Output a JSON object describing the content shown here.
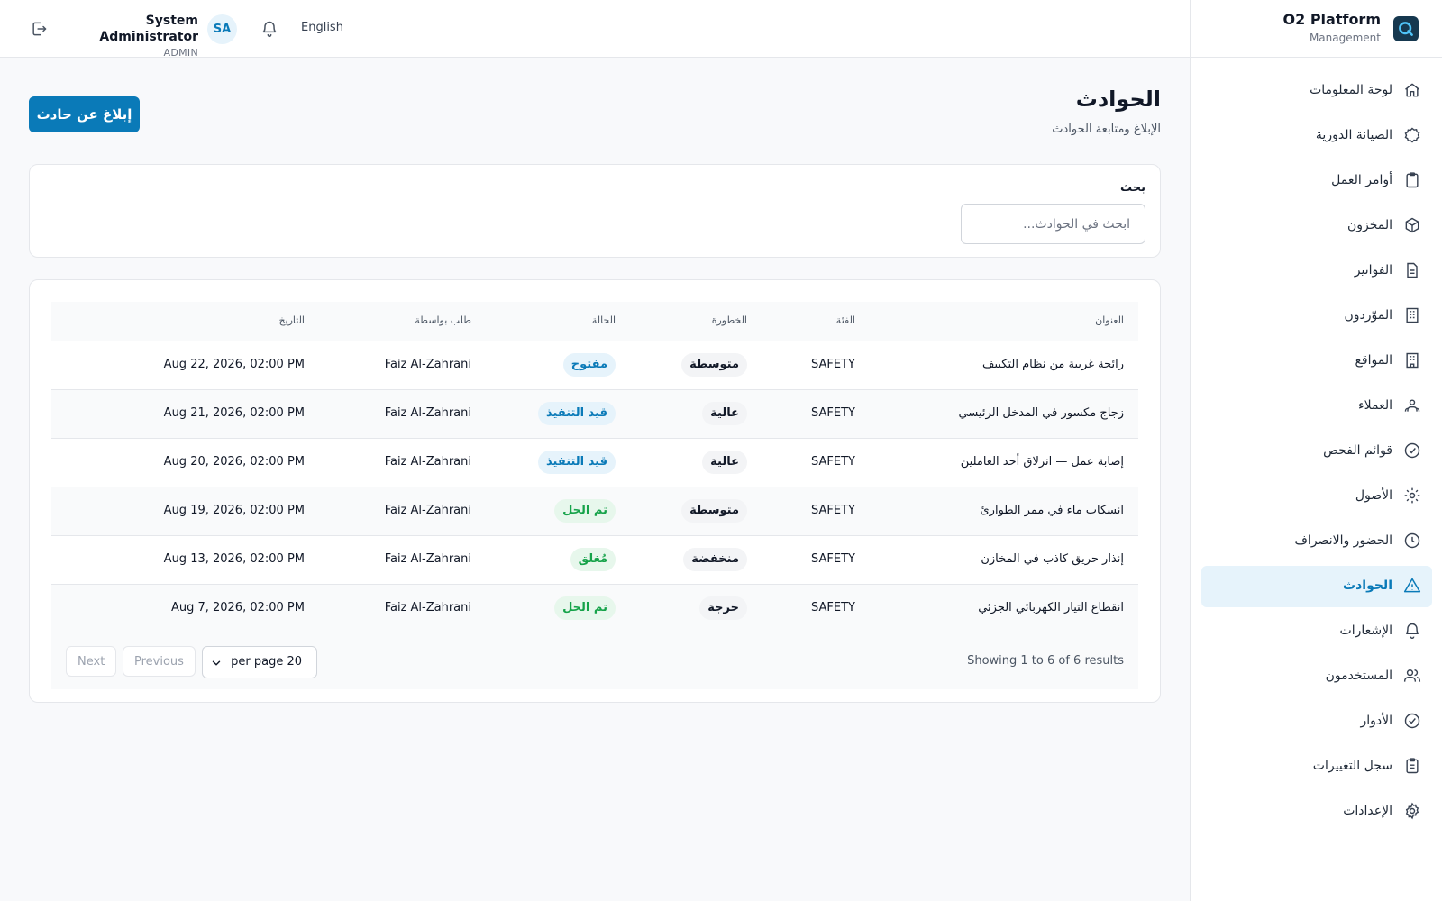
{
  "topbar": {
    "user_name": "System Administrator",
    "user_role": "ADMIN",
    "avatar_initials": "SA",
    "language": "English"
  },
  "brand": {
    "title": "O2 Platform",
    "subtitle": "Management"
  },
  "sidebar": {
    "items": [
      {
        "label": "لوحة المعلومات",
        "icon": "home-icon"
      },
      {
        "label": "الصيانة الدورية",
        "icon": "badge-icon"
      },
      {
        "label": "أوامر العمل",
        "icon": "clipboard-icon"
      },
      {
        "label": "المخزون",
        "icon": "box-icon"
      },
      {
        "label": "الفواتير",
        "icon": "document-icon"
      },
      {
        "label": "الموّردون",
        "icon": "building-icon"
      },
      {
        "label": "المواقع",
        "icon": "building-icon"
      },
      {
        "label": "العملاء",
        "icon": "user-group-icon"
      },
      {
        "label": "قوائم الفحص",
        "icon": "check-circle-icon"
      },
      {
        "label": "الأصول",
        "icon": "cog-icon"
      },
      {
        "label": "الحضور والانصراف",
        "icon": "clock-icon"
      },
      {
        "label": "الحوادث",
        "icon": "warning-triangle-icon",
        "active": true
      },
      {
        "label": "الإشعارات",
        "icon": "bell-icon"
      },
      {
        "label": "المستخدمون",
        "icon": "users-icon"
      },
      {
        "label": "الأدوار",
        "icon": "check-badge-icon"
      },
      {
        "label": "سجل التغييرات",
        "icon": "clipboard-list-icon"
      },
      {
        "label": "الإعدادات",
        "icon": "settings-icon"
      }
    ]
  },
  "page": {
    "title": "الحوادث",
    "subtitle": "الإبلاغ ومتابعة الحوادث",
    "report_button": "إبلاغ عن حادث"
  },
  "search": {
    "label": "بحث",
    "placeholder": "ابحث في الحوادث..."
  },
  "table": {
    "columns": {
      "title": "العنوان",
      "category": "الفئة",
      "severity": "الخطورة",
      "status": "الحالة",
      "requested_by": "طلب بواسطة",
      "date": "التاريخ"
    },
    "rows": [
      {
        "title": "رائحة غريبة من نظام التكييف",
        "category": "SAFETY",
        "severity": "متوسطة",
        "status": "مفتوح",
        "status_kind": "open",
        "requested_by": "Faiz Al-Zahrani",
        "date": "Aug 22, 2026, 02:00 PM"
      },
      {
        "title": "زجاج مكسور في المدخل الرئيسي",
        "category": "SAFETY",
        "severity": "عالية",
        "status": "قيد التنفيذ",
        "status_kind": "prog",
        "requested_by": "Faiz Al-Zahrani",
        "date": "Aug 21, 2026, 02:00 PM"
      },
      {
        "title": "إصابة عمل — انزلاق أحد العاملين",
        "category": "SAFETY",
        "severity": "عالية",
        "status": "قيد التنفيذ",
        "status_kind": "prog",
        "requested_by": "Faiz Al-Zahrani",
        "date": "Aug 20, 2026, 02:00 PM"
      },
      {
        "title": "انسكاب ماء في ممر الطوارئ",
        "category": "SAFETY",
        "severity": "متوسطة",
        "status": "تم الحل",
        "status_kind": "resolved",
        "requested_by": "Faiz Al-Zahrani",
        "date": "Aug 19, 2026, 02:00 PM"
      },
      {
        "title": "إنذار حريق كاذب في المخازن",
        "category": "SAFETY",
        "severity": "منخفضة",
        "status": "مُغلق",
        "status_kind": "closed",
        "requested_by": "Faiz Al-Zahrani",
        "date": "Aug 13, 2026, 02:00 PM"
      },
      {
        "title": "انقطاع التيار الكهربائي الجزئي",
        "category": "SAFETY",
        "severity": "حرجة",
        "status": "تم الحل",
        "status_kind": "resolved",
        "requested_by": "Faiz Al-Zahrani",
        "date": "Aug 7, 2026, 02:00 PM"
      }
    ]
  },
  "pagination": {
    "summary": "Showing 1 to 6 of 6 results",
    "per_page": "per page 20",
    "previous": "Previous",
    "next": "Next"
  },
  "colors": {
    "accent": "#0a7ab8",
    "active_bg": "#e6f3fb",
    "resolved": "#16a34a",
    "logo_bg": "#16384f"
  }
}
